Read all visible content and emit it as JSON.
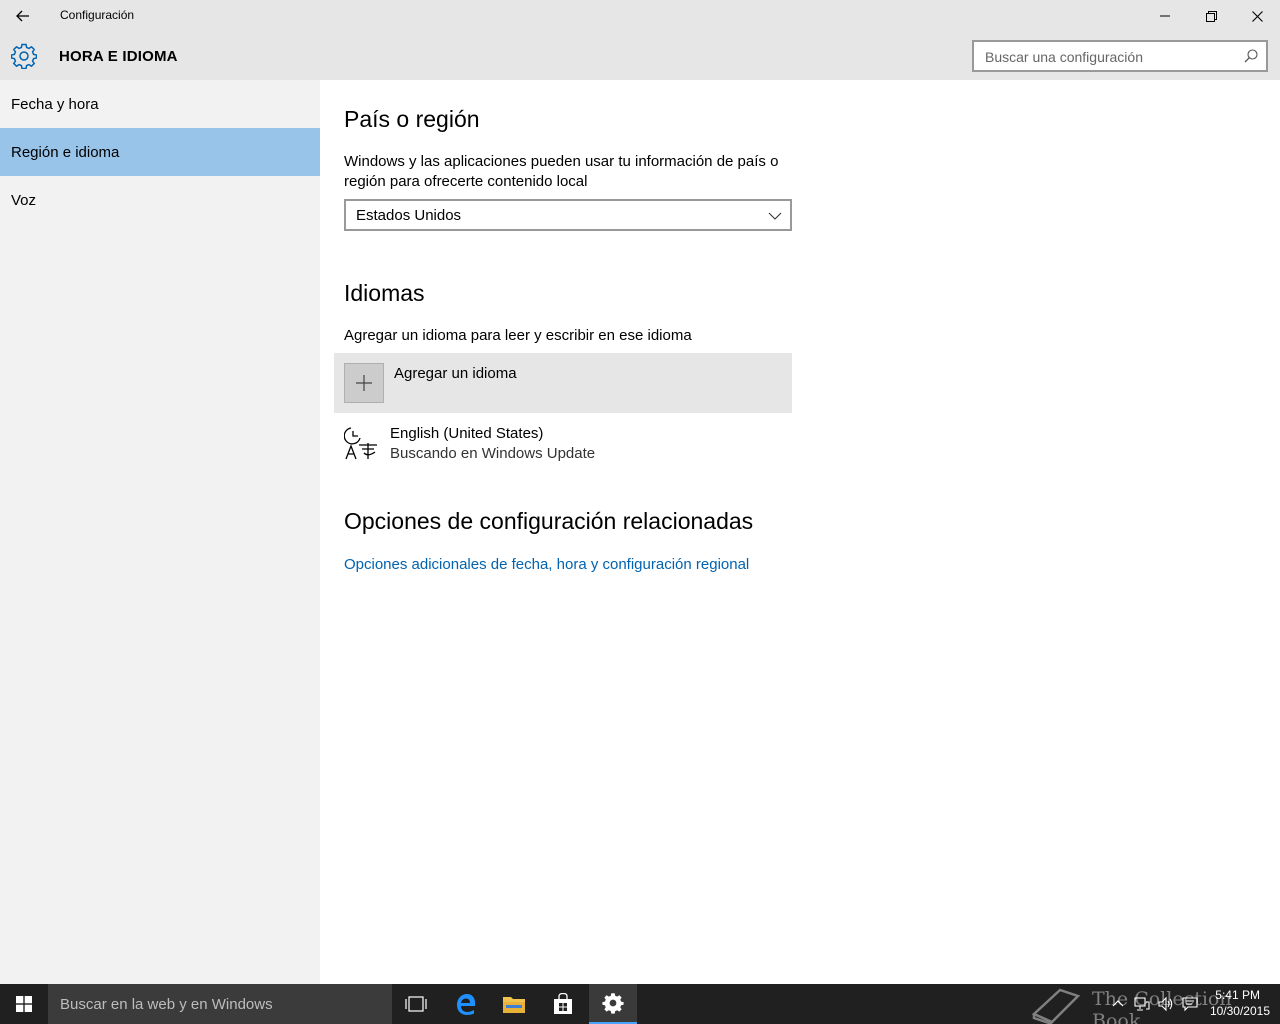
{
  "window": {
    "title": "Configuración",
    "controls": [
      "minimize",
      "restore",
      "close"
    ]
  },
  "header": {
    "section_title": "HORA E IDIOMA",
    "search_placeholder": "Buscar una configuración"
  },
  "sidebar": {
    "items": [
      {
        "label": "Fecha y hora",
        "active": false
      },
      {
        "label": "Región e idioma",
        "active": true
      },
      {
        "label": "Voz",
        "active": false
      }
    ]
  },
  "main": {
    "country_heading": "País o región",
    "country_description_line1": "Windows y las aplicaciones pueden usar tu información de país o",
    "country_description_line2": "región para ofrecerte contenido local",
    "country_selected": "Estados Unidos",
    "languages_heading": "Idiomas",
    "languages_description": "Agregar un idioma para leer y escribir en ese idioma",
    "add_language_label": "Agregar un idioma",
    "languages": [
      {
        "name": "English (United States)",
        "status": "Buscando en Windows Update"
      }
    ],
    "related_heading": "Opciones de configuración relacionadas",
    "related_link": "Opciones adicionales de fecha, hora y configuración regional"
  },
  "taskbar": {
    "search_placeholder": "Buscar en la web y en Windows",
    "time": "5:41 PM",
    "date": "10/30/2015",
    "watermark": "The Collection Book"
  },
  "colors": {
    "accent": "#0063b1",
    "selected_nav": "#99c4ea",
    "chrome": "#e6e6e6",
    "sidebar": "#f2f2f2",
    "taskbar": "#202020"
  }
}
